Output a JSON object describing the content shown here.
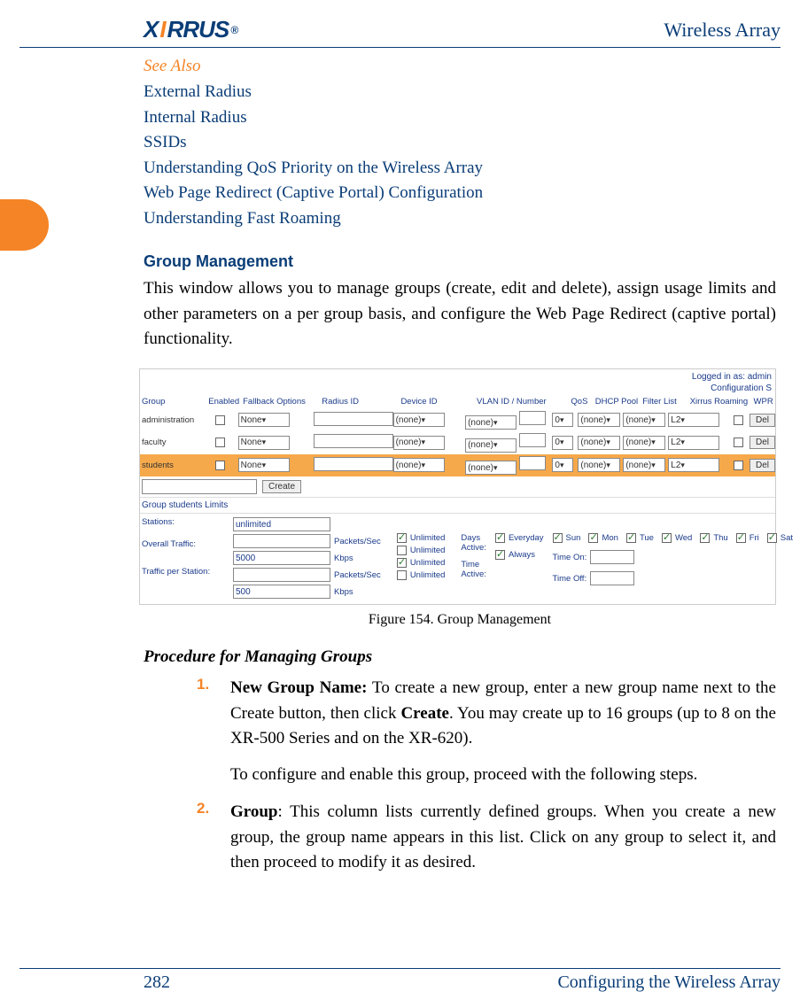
{
  "header": {
    "logo_text_1": "X",
    "logo_text_2": "I",
    "logo_text_3": "RRUS",
    "title": "Wireless Array"
  },
  "see_also": {
    "heading": "See Also",
    "links": [
      "External Radius",
      "Internal Radius",
      "SSIDs",
      "Understanding QoS Priority on the Wireless Array",
      "Web Page Redirect (Captive Portal) Configuration",
      "Understanding Fast Roaming"
    ]
  },
  "section": {
    "title": "Group Management",
    "intro": "This window allows you to manage groups (create, edit and delete), assign usage limits and other parameters on a per group basis, and configure the Web Page Redirect (captive portal) functionality."
  },
  "figure": {
    "top_right": {
      "logged_in": "Logged in as: admin",
      "config": "Configuration S"
    },
    "headers": {
      "group": "Group",
      "enabled": "Enabled",
      "fallback": "Fallback Options",
      "radius": "Radius ID",
      "device": "Device ID",
      "vlan": "VLAN ID / Number",
      "qos": "QoS",
      "dhcp": "DHCP Pool",
      "filter": "Filter List",
      "roaming": "Xirrus Roaming",
      "wpr": "WPR",
      "del": ""
    },
    "rows": [
      {
        "group": "administration",
        "fallback": "None",
        "device": "(none)",
        "vlan": "(none)",
        "qos": "0",
        "dhcp": "(none)",
        "filter": "(none)",
        "roaming": "L2",
        "del": "Del"
      },
      {
        "group": "faculty",
        "fallback": "None",
        "device": "(none)",
        "vlan": "(none)",
        "qos": "0",
        "dhcp": "(none)",
        "filter": "(none)",
        "roaming": "L2",
        "del": "Del"
      },
      {
        "group": "students",
        "fallback": "None",
        "device": "(none)",
        "vlan": "(none)",
        "qos": "0",
        "dhcp": "(none)",
        "filter": "(none)",
        "roaming": "L2",
        "del": "Del",
        "highlight": true
      }
    ],
    "create_label": "Create",
    "limits": {
      "title": "Group students   Limits",
      "stations_label": "Stations:",
      "stations_value": "unlimited",
      "overall_label": "Overall Traffic:",
      "per_station_label": "Traffic per Station:",
      "pkts": "Packets/Sec",
      "kbps": "Kbps",
      "unlimited": "Unlimited",
      "val_5000": "5000",
      "val_500": "500",
      "days_active": "Days Active:",
      "time_active": "Time Active:",
      "everyday": "Everyday",
      "always": "Always",
      "time_on": "Time On:",
      "time_off": "Time Off:",
      "days": [
        "Sun",
        "Mon",
        "Tue",
        "Wed",
        "Thu",
        "Fri",
        "Sat"
      ]
    },
    "caption": "Figure 154. Group Management"
  },
  "procedure": {
    "heading": "Procedure for Managing Groups",
    "items": [
      {
        "num": "1.",
        "lead": "New Group Name: ",
        "text_a": "To create a new group, enter a new group name next to the Create button, then click ",
        "bold": "Create",
        "text_b": ". You may create up to 16  groups (up to 8 on the XR-500 Series and on the XR-620).",
        "sub": "To configure and enable this group, proceed with the following steps."
      },
      {
        "num": "2.",
        "lead": "Group",
        "text_a": ": This column lists currently defined groups. When you create a new group, the group name appears in this list. Click on any group to select it, and then proceed to modify it as desired.",
        "bold": "",
        "text_b": "",
        "sub": ""
      }
    ]
  },
  "footer": {
    "page": "282",
    "section": "Configuring the Wireless Array"
  }
}
